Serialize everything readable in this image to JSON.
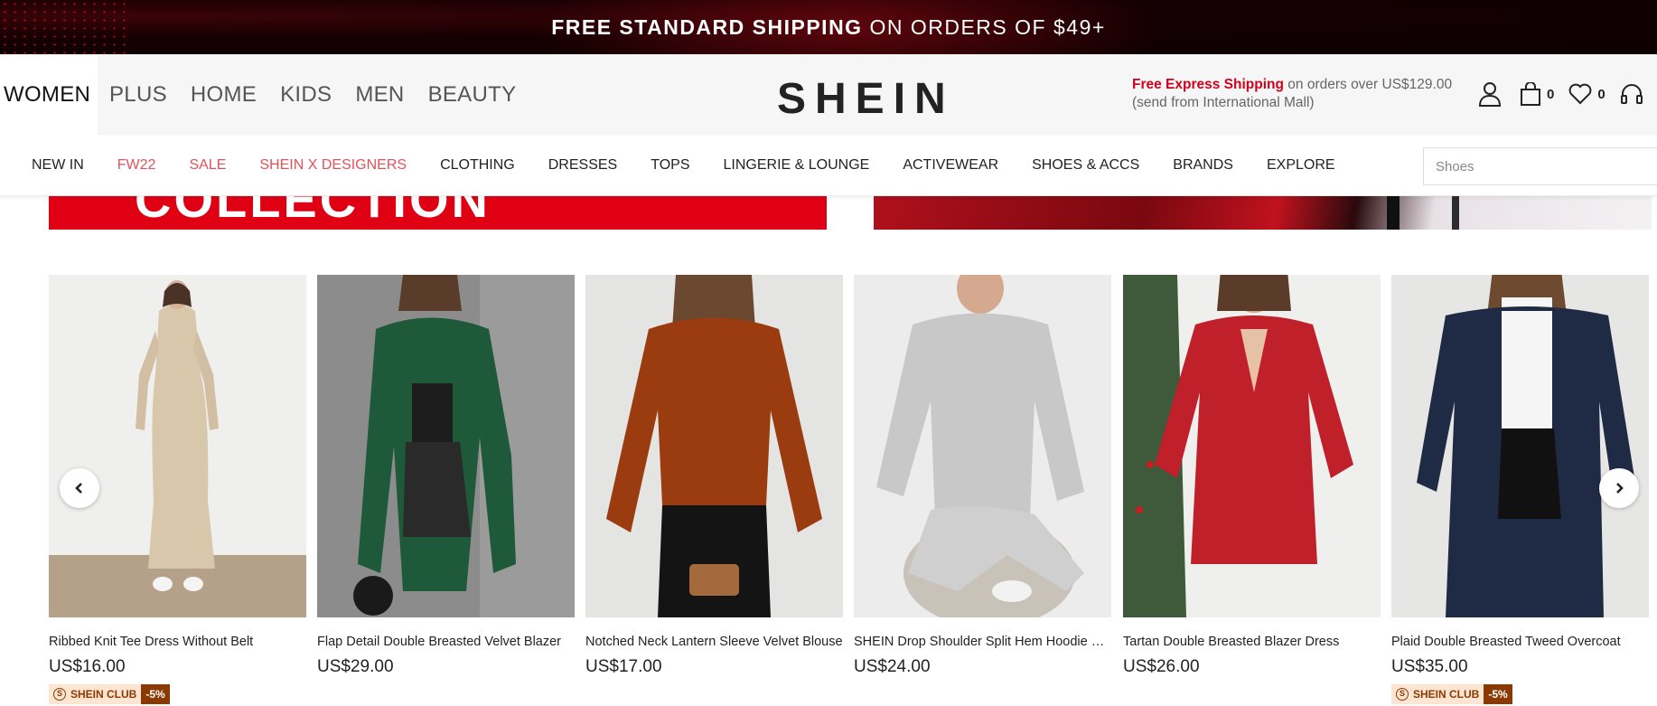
{
  "promo": {
    "bold": "FREE STANDARD SHIPPING",
    "rest": "ON ORDERS OF $49+"
  },
  "header": {
    "categories": [
      "WOMEN",
      "PLUS",
      "HOME",
      "KIDS",
      "MEN",
      "BEAUTY"
    ],
    "logo": "SHEIN",
    "express_highlight": "Free Express Shipping",
    "express_rest": " on orders over US$129.00",
    "express_sub": "(send from International Mall)",
    "bag_count": "0",
    "wishlist_count": "0",
    "icons": [
      "user-icon",
      "bag-icon",
      "heart-icon",
      "headset-icon"
    ]
  },
  "nav": {
    "links": [
      "NEW IN",
      "FW22",
      "SALE",
      "SHEIN X DESIGNERS",
      "CLOTHING",
      "DRESSES",
      "TOPS",
      "LINGERIE & LOUNGE",
      "ACTIVEWEAR",
      "SHOES & ACCS",
      "BRANDS",
      "EXPLORE"
    ],
    "highlighted": [
      "FW22",
      "SALE",
      "SHEIN X DESIGNERS"
    ],
    "search_placeholder": "Shoes"
  },
  "hero": {
    "left_text": "COLLECTION"
  },
  "carousel": {
    "prev_icon": "chevron-left-icon",
    "next_icon": "chevron-right-icon",
    "products": [
      {
        "title": "Ribbed Knit Tee Dress Without Belt",
        "price": "US$16.00",
        "club": "SHEIN CLUB",
        "discount": "-5%"
      },
      {
        "title": "Flap Detail Double Breasted Velvet Blazer",
        "price": "US$29.00"
      },
      {
        "title": "Notched Neck Lantern Sleeve Velvet Blouse",
        "price": "US$17.00"
      },
      {
        "title": "SHEIN Drop Shoulder Split Hem Hoodie & Sweatpants",
        "price": "US$24.00"
      },
      {
        "title": "Tartan Double Breasted Blazer Dress",
        "price": "US$26.00"
      },
      {
        "title": "Plaid Double Breasted Tweed Overcoat",
        "price": "US$35.00",
        "club": "SHEIN CLUB",
        "discount": "-5%"
      }
    ]
  },
  "colors": {
    "brand_red": "#d0021b",
    "nav_highlight": "#e1525b",
    "club_bg": "#fde5d2",
    "club_dark": "#8a3a00"
  }
}
